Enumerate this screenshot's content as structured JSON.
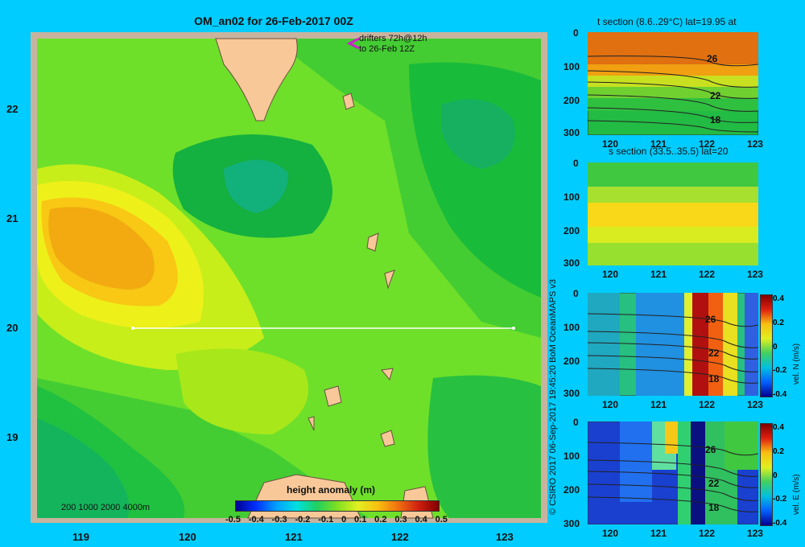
{
  "map": {
    "title": "OM_an02 for 26-Feb-2017 00Z",
    "x_ticks": [
      "119",
      "120",
      "121",
      "122",
      "123"
    ],
    "y_ticks": [
      "22",
      "21",
      "20",
      "19"
    ],
    "drifters_line1": "drifters 72h@12h",
    "drifters_line2": "to 26-Feb 12Z",
    "scale_text": "200  1000  2000  4000m",
    "colorbar_label": "height anomaly  (m)",
    "colorbar_ticks": [
      "-0.5",
      "-0.4",
      "-0.3",
      "-0.2",
      "-0.1",
      "0",
      "0.1",
      "0.2",
      "0.3",
      "0.4",
      "0.5"
    ],
    "section_line_lat": "20",
    "colors": {
      "land": "#f8c898",
      "frame": "#c8b49e",
      "background": "#00ccff"
    }
  },
  "credit": "© CSIRO 2017   06-Sep-2017 19:45:20 BoM OceanMAPS v3",
  "panels": [
    {
      "id": "t-section",
      "title": "t section (8.6..29°C) lat=19.95 at",
      "y_ticks": [
        "0",
        "100",
        "200",
        "300"
      ],
      "x_ticks": [
        "120",
        "121",
        "122",
        "123"
      ],
      "contour_labels": [
        "26",
        "22",
        "18"
      ]
    },
    {
      "id": "s-section",
      "title": "s section (33.5..35.5) lat=20",
      "y_ticks": [
        "0",
        "100",
        "200",
        "300"
      ],
      "x_ticks": [
        "120",
        "121",
        "122",
        "123"
      ]
    },
    {
      "id": "vel-n",
      "title": "",
      "y_ticks": [
        "0",
        "100",
        "200",
        "300"
      ],
      "x_ticks": [
        "120",
        "121",
        "122",
        "123"
      ],
      "contour_labels": [
        "26",
        "22",
        "18"
      ],
      "colorbar_label": "vel. N  (m/s)",
      "colorbar_ticks": [
        "0.4",
        "0.2",
        "0",
        "-0.2",
        "-0.4"
      ]
    },
    {
      "id": "vel-e",
      "title": "",
      "y_ticks": [
        "0",
        "100",
        "200",
        "300"
      ],
      "x_ticks": [
        "120",
        "121",
        "122",
        "123"
      ],
      "contour_labels": [
        "26",
        "22",
        "18"
      ],
      "colorbar_label": "vel. E  (m/s)",
      "colorbar_ticks": [
        "0.4",
        "0.2",
        "0",
        "-0.2",
        "-0.4"
      ]
    }
  ]
}
